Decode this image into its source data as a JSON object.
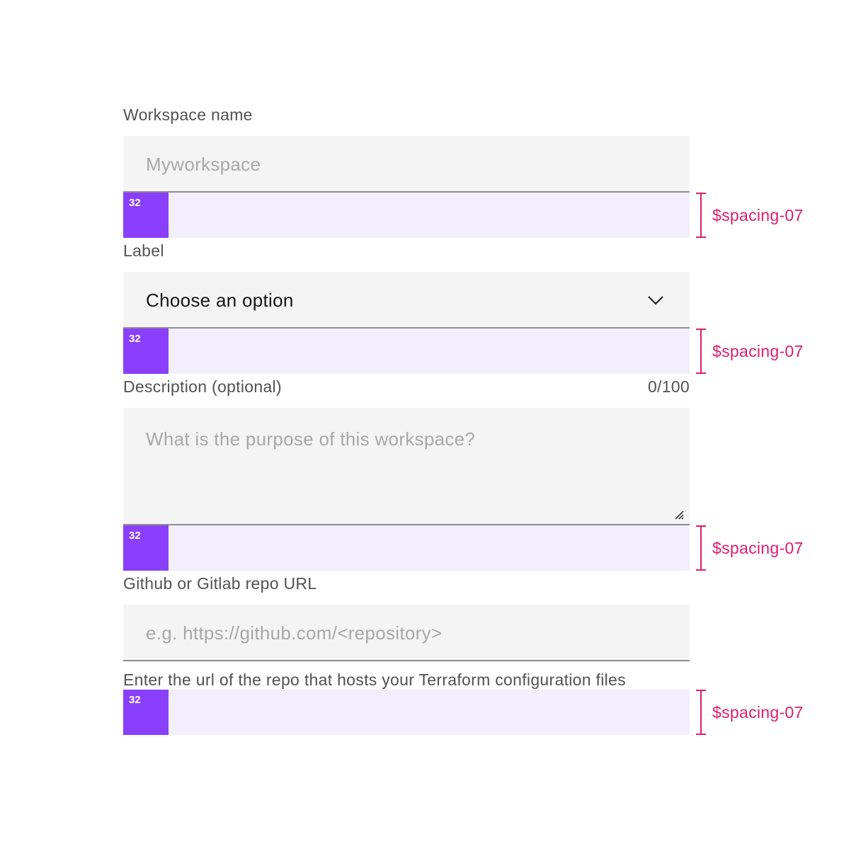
{
  "workspace_name": {
    "label": "Workspace name",
    "placeholder": "Myworkspace"
  },
  "select": {
    "label": "Label",
    "selected": "Choose an option",
    "icon": "chevron-down-icon"
  },
  "description": {
    "label": "Description (optional)",
    "counter": "0/100",
    "placeholder": "What is the purpose of this workspace?",
    "icon": "resize-handle-icon"
  },
  "repo_url": {
    "label": "Github or Gitlab repo URL",
    "placeholder": "e.g. https://github.com/<repository>",
    "helper": "Enter the url of the repo that hosts your Terraform configuration files"
  },
  "spacing_annotations": [
    {
      "value": "32",
      "token": "$spacing-07"
    },
    {
      "value": "32",
      "token": "$spacing-07"
    },
    {
      "value": "32",
      "token": "$spacing-07"
    },
    {
      "value": "32",
      "token": "$spacing-07"
    }
  ],
  "colors": {
    "field_background": "#f4f4f4",
    "field_border": "#8d8d8d",
    "spacing_token": "#8a3ffc",
    "spacing_area": "#f3eefd",
    "annotation": "#da1e6e",
    "label_text": "#525252",
    "placeholder_text": "#a8a8a8"
  }
}
